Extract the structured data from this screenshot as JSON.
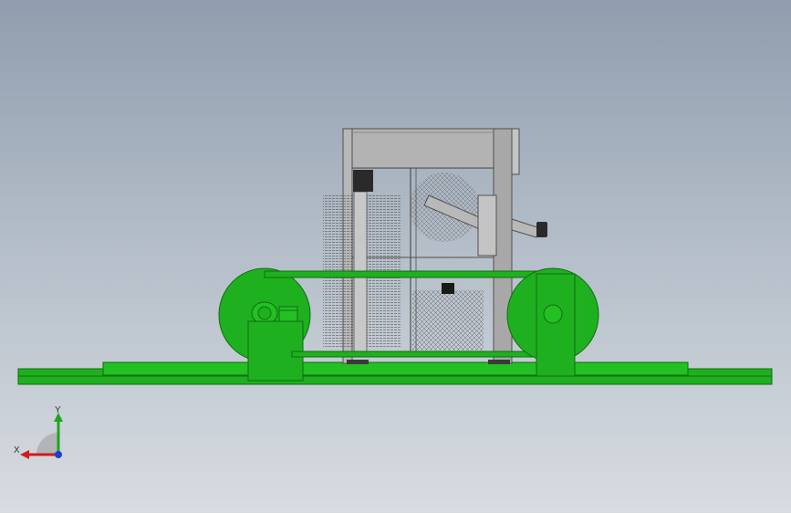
{
  "viewport": {
    "colors": {
      "background_top": "#8f9dae",
      "background_bottom": "#d8dce1",
      "model_green": "#1fb01f",
      "model_green_dark": "#0f6d0f",
      "frame_gray": "#b8b8b8",
      "frame_dark": "#505050"
    },
    "model_parts": [
      "base-plate",
      "left-pulley-wheel",
      "right-pulley-wheel",
      "motor-housing",
      "belt-upper",
      "belt-lower",
      "machine-frame",
      "top-beam",
      "feed-arm",
      "brush-roller",
      "needle-array"
    ]
  },
  "triad": {
    "x_label": "X",
    "y_label": "Y",
    "x_color": "#d11c1c",
    "y_color": "#1ea51e",
    "z_color": "#1c3dd1"
  }
}
